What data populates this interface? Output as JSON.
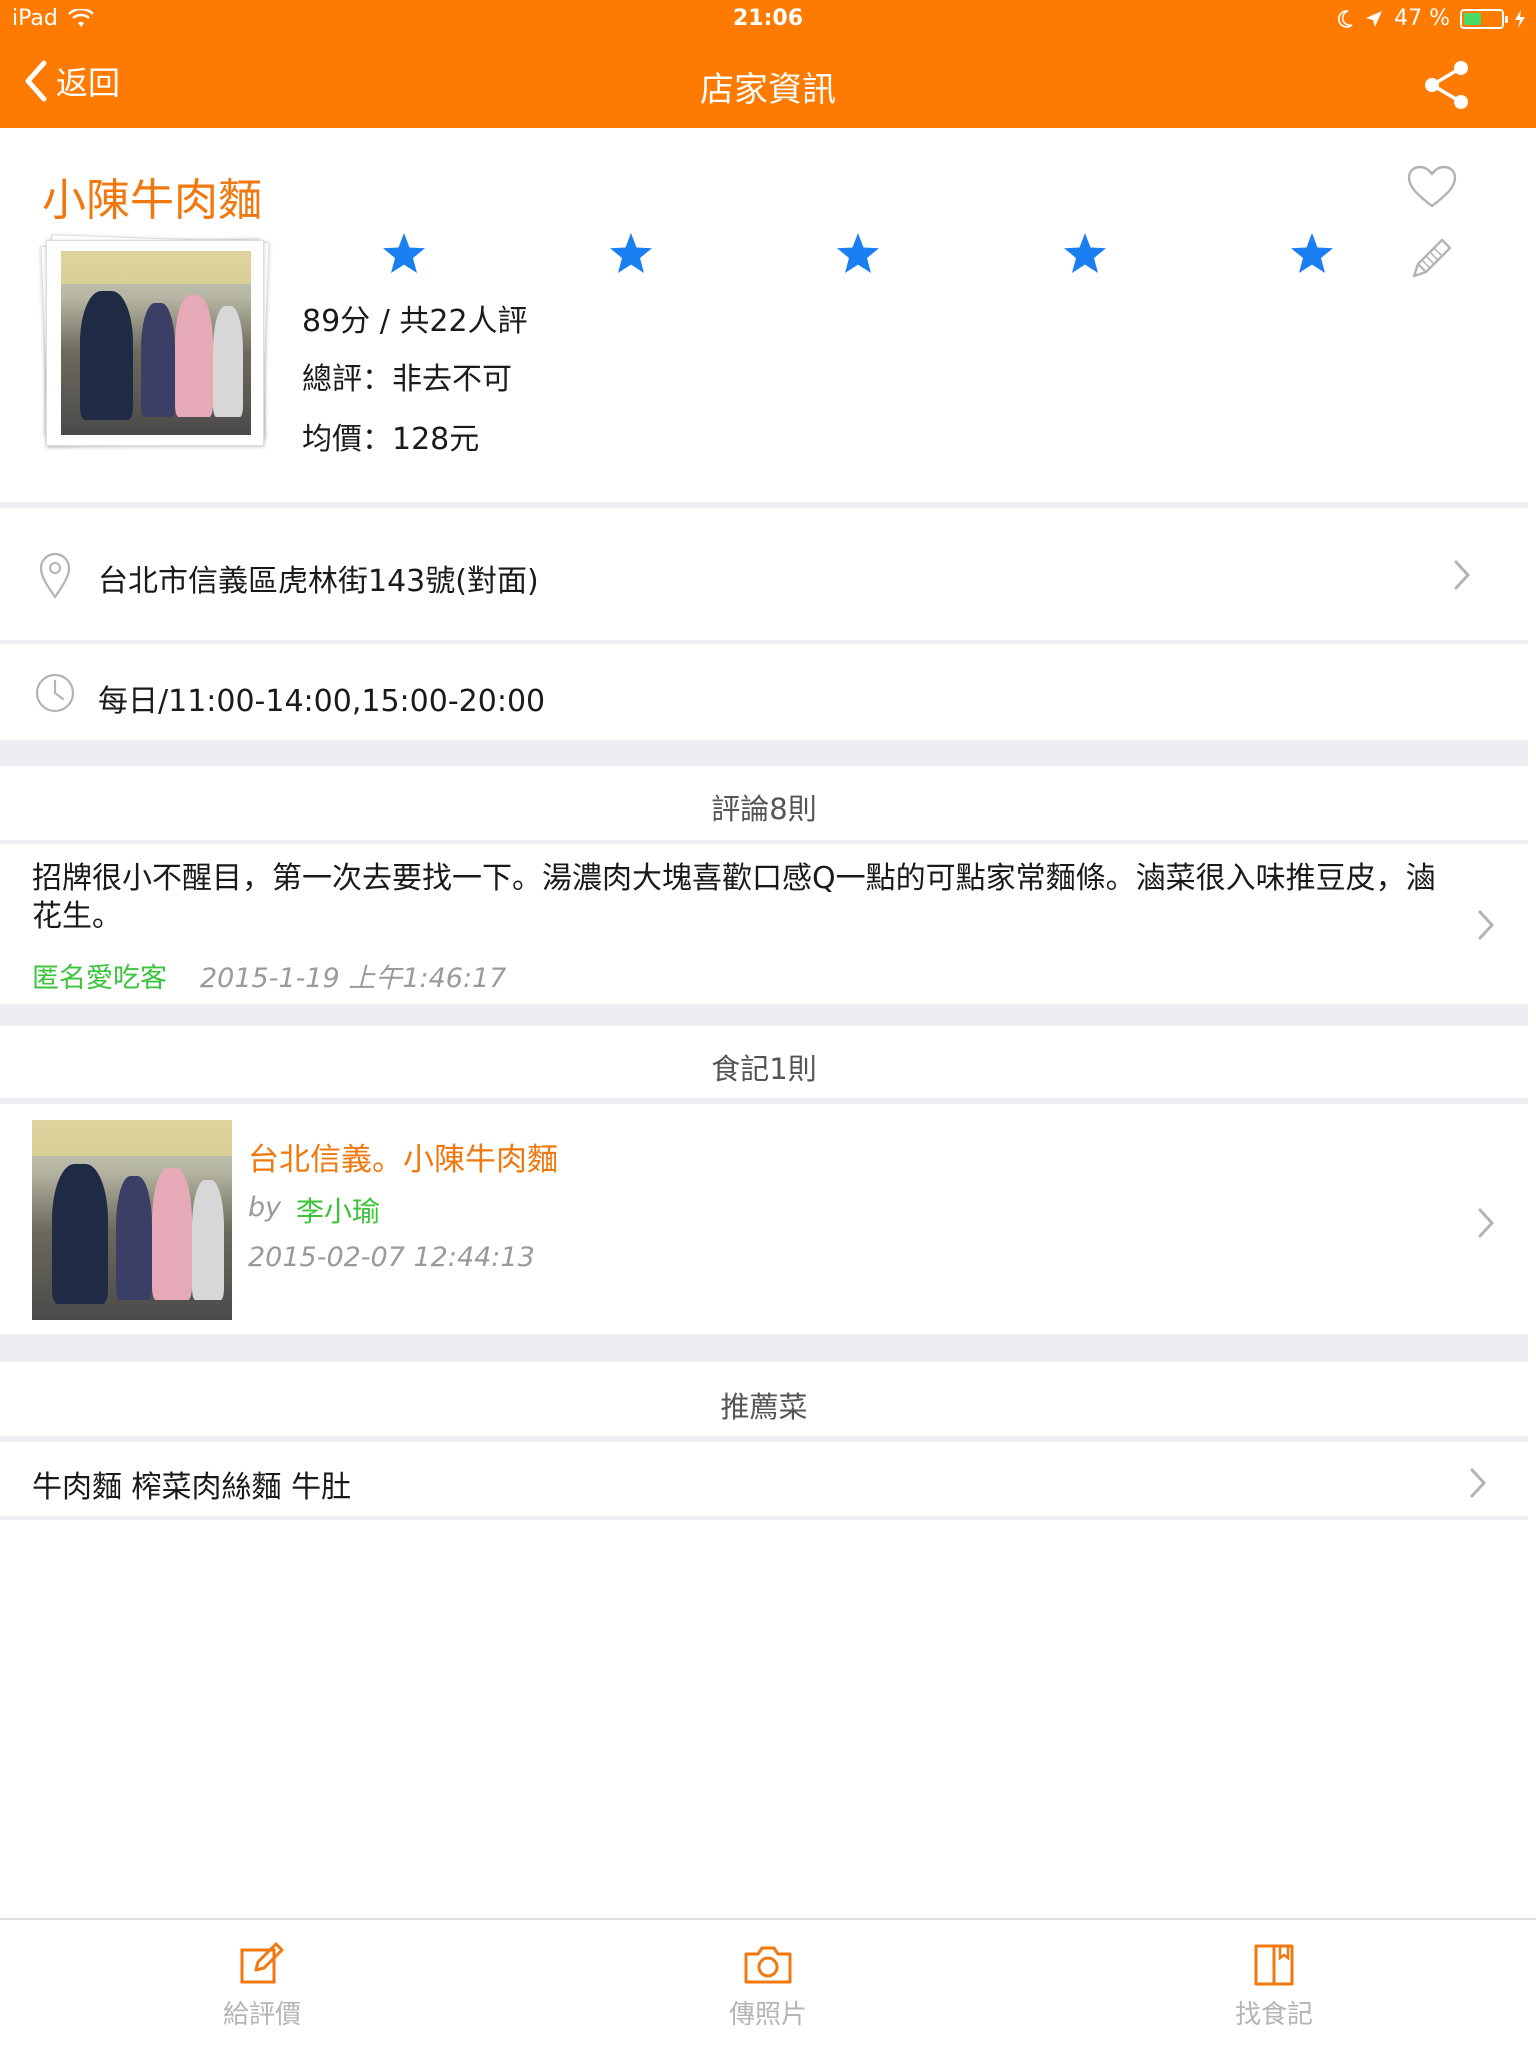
{
  "status_bar": {
    "device": "iPad",
    "time": "21:06",
    "battery_text": "47 %",
    "battery_level": 0.47
  },
  "nav": {
    "back_label": "返回",
    "title": "店家資訊",
    "share_icon": "share-icon"
  },
  "store": {
    "name": "小陳牛肉麵",
    "photo_count": "3",
    "rating_stars": 5,
    "score_text": "89分 / 共22人評",
    "overall_text": "總評：非去不可",
    "price_text": "均價：128元",
    "star_color": "#1a7ff0"
  },
  "address": {
    "text": "台北市信義區虎林街143號(對面)"
  },
  "hours": {
    "text": "每日/11:00-14:00,15:00-20:00"
  },
  "reviews": {
    "header": "評論8則",
    "items": [
      {
        "text": "招牌很小不醒目，第一次去要找一下。湯濃肉大塊喜歡口感Q一點的可點家常麵條。滷菜很入味推豆皮，滷花生。",
        "author": "匿名愛吃客",
        "date": "2015-1-19 上午1:46:17"
      }
    ]
  },
  "diaries": {
    "header": "食記1則",
    "items": [
      {
        "title": "台北信義。小陳牛肉麵",
        "by": "by",
        "author": "李小瑜",
        "date": "2015-02-07 12:44:13"
      }
    ]
  },
  "dishes": {
    "header": "推薦菜",
    "text": "牛肉麵 榨菜肉絲麵 牛肚"
  },
  "tabbar": {
    "items": [
      {
        "label": "給評價",
        "icon": "edit-icon"
      },
      {
        "label": "傳照片",
        "icon": "camera-icon"
      },
      {
        "label": "找食記",
        "icon": "book-icon"
      }
    ]
  },
  "colors": {
    "brand": "#ff7a00",
    "title_orange": "#f0780f",
    "author_green": "#3cc33c",
    "muted_gray": "#9a9a9a"
  }
}
